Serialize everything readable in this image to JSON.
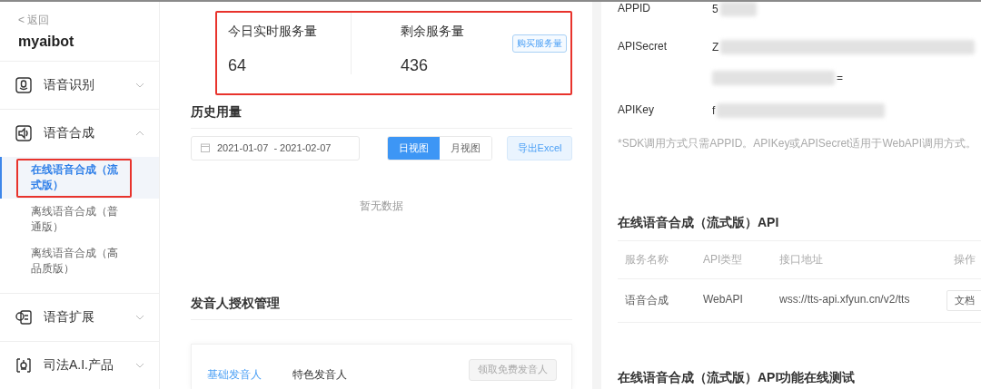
{
  "sidebar": {
    "back": "< 返回",
    "app_name": "myaibot",
    "groups": [
      {
        "label": "语音识别",
        "expanded": false
      },
      {
        "label": "语音合成",
        "expanded": true,
        "children": [
          {
            "label": "在线语音合成（流式版）",
            "selected": true,
            "highlighted": true
          },
          {
            "label": "离线语音合成（普通版）",
            "selected": false,
            "highlighted": false
          },
          {
            "label": "离线语音合成（高品质版）",
            "selected": false,
            "highlighted": false
          }
        ]
      },
      {
        "label": "语音扩展",
        "expanded": false
      },
      {
        "label": "司法A.I.产品",
        "expanded": false
      }
    ]
  },
  "stats": {
    "highlighted": true,
    "items": [
      {
        "label": "今日实时服务量",
        "value": "64"
      },
      {
        "label": "剩余服务量",
        "value": "436"
      }
    ],
    "buy_button": "购买服务量"
  },
  "history": {
    "title": "历史用量",
    "date_range": "2021-01-07  - 2021-02-07",
    "views": [
      {
        "label": "日视图",
        "selected": true
      },
      {
        "label": "月视图",
        "selected": false
      }
    ],
    "export_button": "导出Excel",
    "empty_text": "暂无数据"
  },
  "voice_auth": {
    "title": "发音人授权管理",
    "tabs": [
      {
        "label": "基础发音人",
        "selected": true
      },
      {
        "label": "特色发音人",
        "selected": false
      }
    ],
    "claim_button": "领取免费发音人"
  },
  "credentials": [
    {
      "label": "APPID",
      "lines": [
        "5"
      ]
    },
    {
      "label": "APISecret",
      "lines": [
        "Z",
        "="
      ]
    },
    {
      "label": "APIKey",
      "lines": [
        "f"
      ]
    }
  ],
  "credentials_note": "*SDK调用方式只需APPID。APIKey或APISecret适用于WebAPI调用方式。",
  "api": {
    "title": "在线语音合成（流式版）API",
    "columns": [
      "服务名称",
      "API类型",
      "接口地址",
      "操作"
    ],
    "rows": [
      {
        "name": "语音合成",
        "type": "WebAPI",
        "url": "wss://tts-api.xfyun.cn/v2/tts",
        "action": "文档"
      }
    ]
  },
  "test_title": "在线语音合成（流式版）API功能在线测试"
}
